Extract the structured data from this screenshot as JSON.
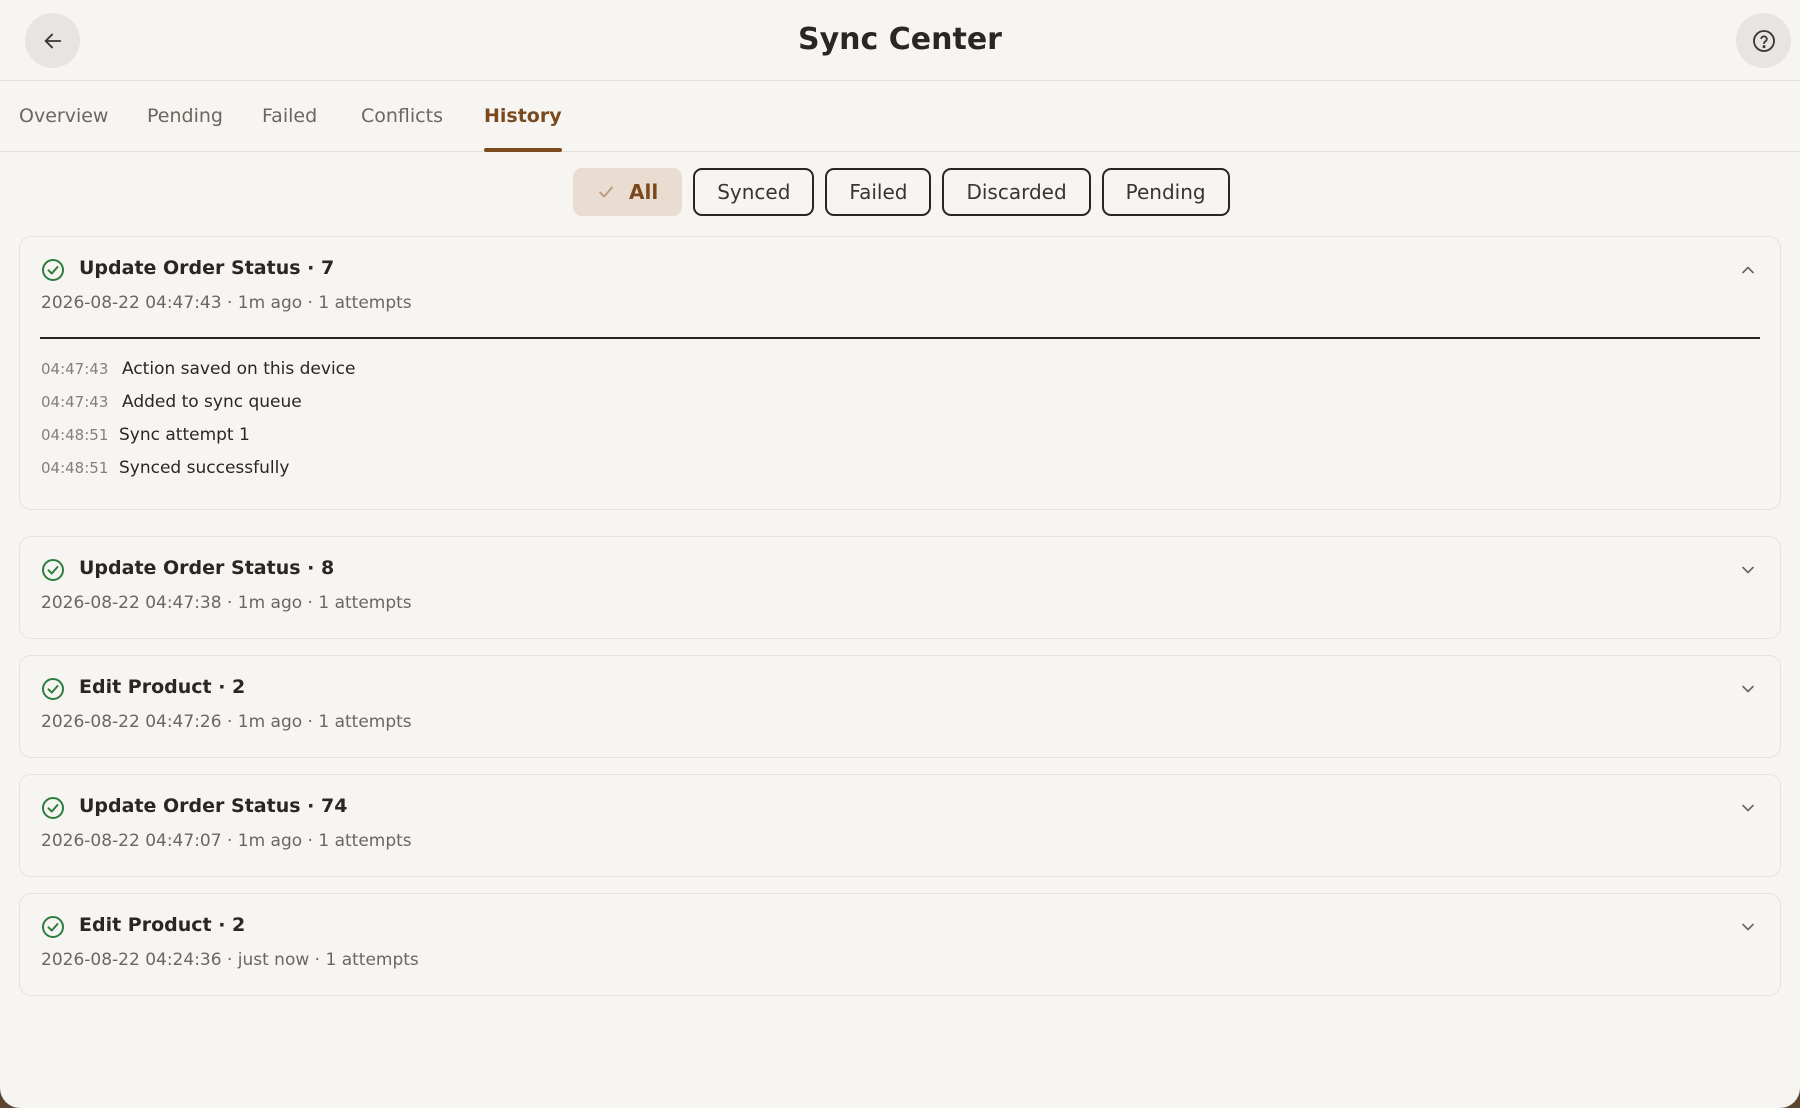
{
  "header": {
    "title": "Sync Center",
    "back_icon": "arrow-left-icon",
    "help_icon": "help-circle-icon"
  },
  "tabs": [
    {
      "label": "Overview",
      "active": false
    },
    {
      "label": "Pending",
      "active": false
    },
    {
      "label": "Failed",
      "active": false
    },
    {
      "label": "Conflicts",
      "active": false
    },
    {
      "label": "History",
      "active": true
    }
  ],
  "filters": [
    {
      "label": "All",
      "selected": true
    },
    {
      "label": "Synced",
      "selected": false
    },
    {
      "label": "Failed",
      "selected": false
    },
    {
      "label": "Discarded",
      "selected": false
    },
    {
      "label": "Pending",
      "selected": false
    }
  ],
  "history": [
    {
      "title": "Update Order Status · 7",
      "meta": "2026-08-22 04:47:43 · 1m ago · 1 attempts",
      "expanded": true,
      "events": [
        {
          "time": "04:47:43",
          "text": "Action saved on this device"
        },
        {
          "time": "04:47:43",
          "text": "Added to sync queue"
        },
        {
          "time": "04:48:51",
          "text": "Sync attempt 1"
        },
        {
          "time": "04:48:51",
          "text": "Synced successfully"
        }
      ]
    },
    {
      "title": "Update Order Status · 8",
      "meta": "2026-08-22 04:47:38 · 1m ago · 1 attempts",
      "expanded": false
    },
    {
      "title": "Edit Product · 2",
      "meta": "2026-08-22 04:47:26 · 1m ago · 1 attempts",
      "expanded": false
    },
    {
      "title": "Update Order Status · 74",
      "meta": "2026-08-22 04:47:07 · 1m ago · 1 attempts",
      "expanded": false
    },
    {
      "title": "Edit Product · 2",
      "meta": "2026-08-22 04:24:36 · just now · 1 attempts",
      "expanded": false
    }
  ],
  "colors": {
    "accent": "#7a4a1e",
    "success": "#2e7d3e",
    "background": "#f6f5f2"
  }
}
